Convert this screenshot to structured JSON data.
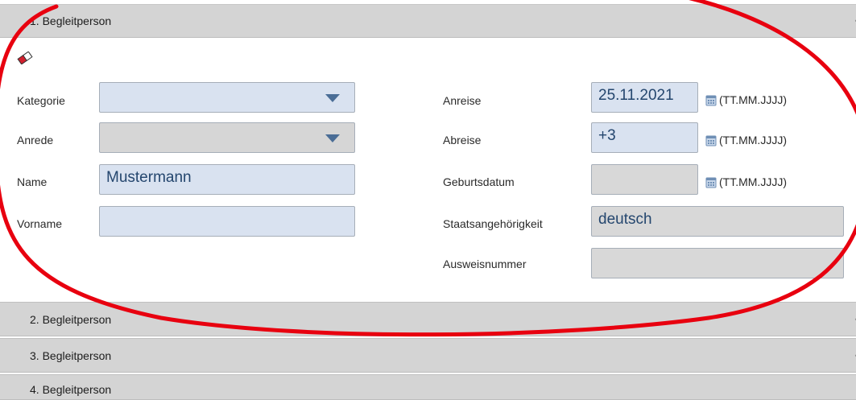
{
  "sections": {
    "s1": "1. Begleitperson",
    "s2": "2. Begleitperson",
    "s3": "3. Begleitperson",
    "s4": "4. Begleitperson"
  },
  "form": {
    "kategorie": {
      "label": "Kategorie",
      "value": ""
    },
    "anrede": {
      "label": "Anrede",
      "value": ""
    },
    "name": {
      "label": "Name",
      "value": "Mustermann"
    },
    "vorname": {
      "label": "Vorname",
      "value": ""
    },
    "anreise": {
      "label": "Anreise",
      "value": "25.11.2021",
      "hint": "(TT.MM.JJJJ)"
    },
    "abreise": {
      "label": "Abreise",
      "value": "+3",
      "hint": "(TT.MM.JJJJ)"
    },
    "geburtsdatum": {
      "label": "Geburtsdatum",
      "value": "",
      "hint": "(TT.MM.JJJJ)"
    },
    "staatsangehoerigkeit": {
      "label": "Staatsangehörigkeit",
      "value": "deutsch"
    },
    "ausweisnummer": {
      "label": "Ausweisnummer",
      "value": ""
    }
  },
  "colors": {
    "field_blue": "#d9e2f0",
    "field_gray": "#d8d8d8",
    "header_gray": "#d4d4d4",
    "value_text": "#24466e",
    "annotation_red": "#e8000f"
  },
  "icons": {
    "clear": "eraser-icon",
    "calendar": "calendar-icon",
    "dropdown": "triangle-down-icon"
  }
}
